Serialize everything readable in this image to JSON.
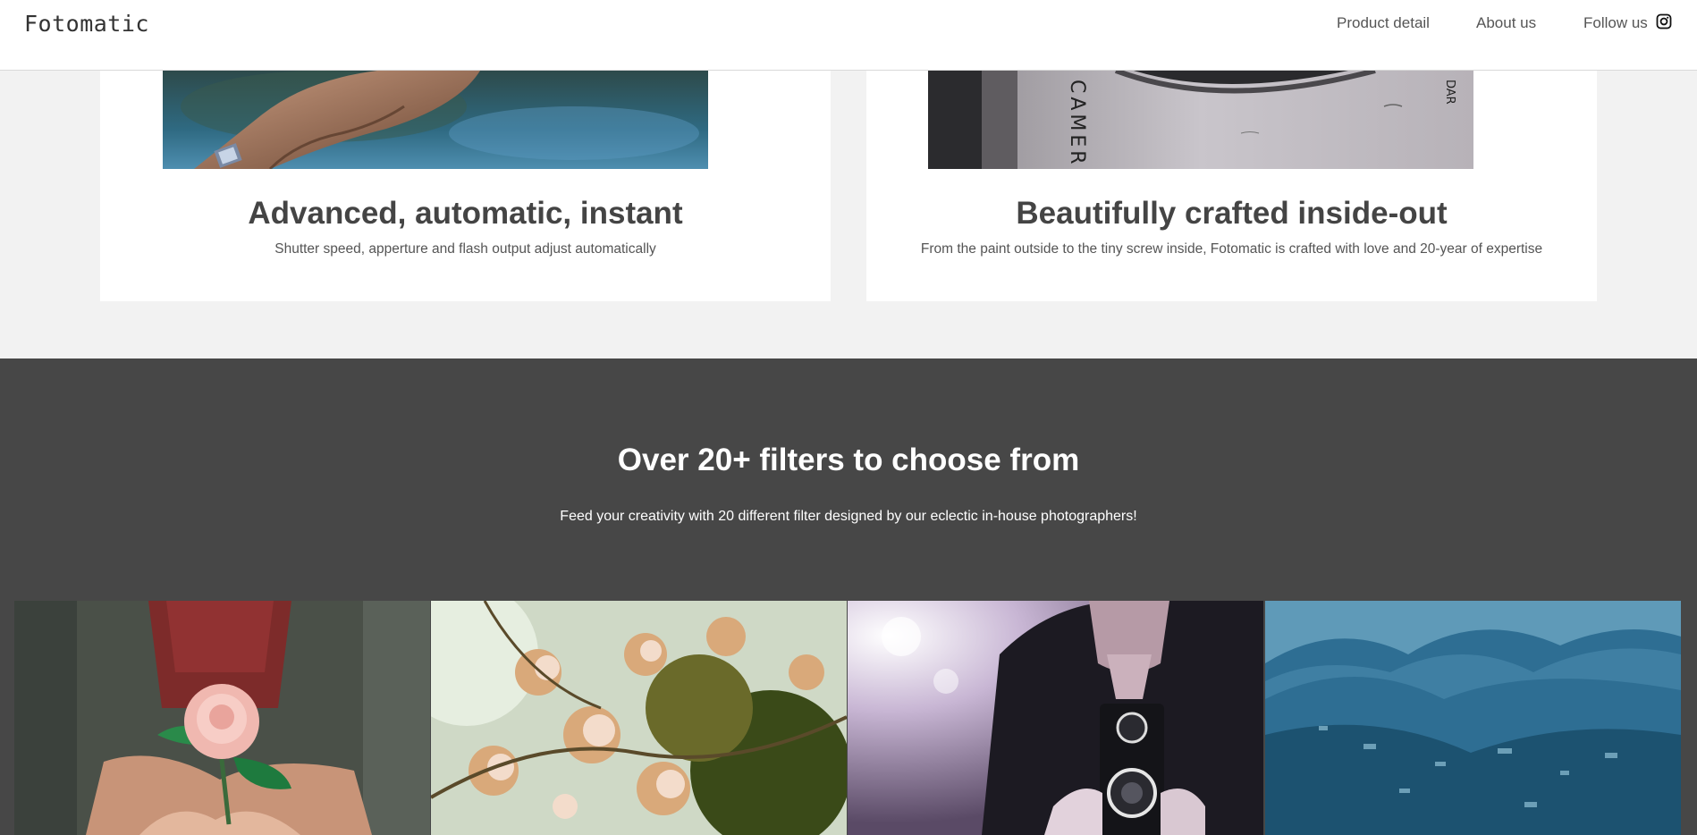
{
  "nav": {
    "logo": "Fotomatic",
    "links": [
      "Product detail",
      "About us",
      "Follow us"
    ],
    "social_icon": "instagram-icon"
  },
  "features": [
    {
      "title": "Advanced, automatic, instant",
      "description": "Shutter speed, apperture and flash output adjust automatically"
    },
    {
      "title": "Beautifully crafted inside-out",
      "description": "From the paint outside to the tiny screw inside, Fotomatic is crafted with love and 20-year of expertise",
      "image_text": [
        "CAMER",
        "DAR"
      ]
    }
  ],
  "filters": {
    "title": "Over 20+ filters to choose from",
    "subtitle": "Feed your creativity with 20 different filter designed by our eclectic in-house photographers!"
  },
  "colors": {
    "header_bg": "#ffffff",
    "page_bg": "#f2f2f2",
    "filters_bg": "#474747",
    "text": "#444444"
  }
}
